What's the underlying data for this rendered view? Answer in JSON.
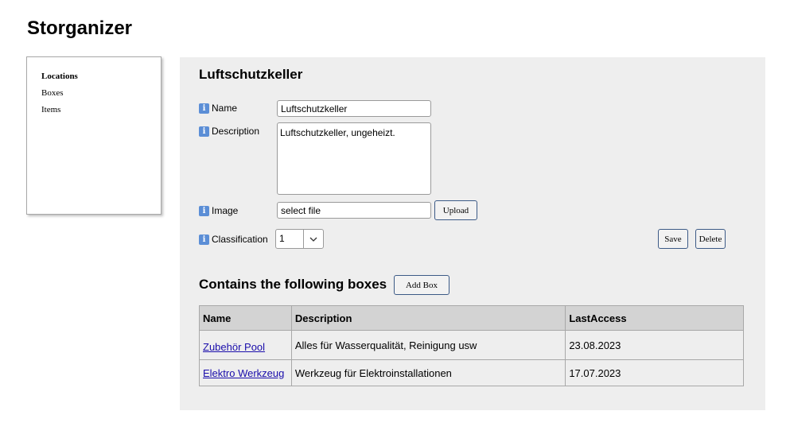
{
  "app": {
    "title": "Storganizer"
  },
  "sidebar": {
    "items": [
      {
        "label": "Locations",
        "active": true
      },
      {
        "label": "Boxes",
        "active": false
      },
      {
        "label": "Items",
        "active": false
      }
    ]
  },
  "location": {
    "title": "Luftschutzkeller",
    "info_icon": "information-icon",
    "fields": {
      "name_label": "Name",
      "name_value": "Luftschutzkeller",
      "description_label": "Description",
      "description_value": "Luftschutzkeller, ungeheizt.",
      "image_label": "Image",
      "image_value": "select file",
      "upload_label": "Upload",
      "classification_label": "Classification",
      "classification_value": "1"
    },
    "actions": {
      "save_label": "Save",
      "delete_label": "Delete"
    }
  },
  "boxes": {
    "title": "Contains the following boxes",
    "add_label": "Add Box",
    "columns": [
      "Name",
      "Description",
      "LastAccess"
    ],
    "rows": [
      [
        "Zubehör Pool",
        "Alles für Wasserqualität, Reinigung usw",
        "23.08.2023"
      ],
      [
        "Elektro Werkzeug",
        "Werkzeug für Elektroinstallationen",
        "17.07.2023"
      ]
    ]
  }
}
